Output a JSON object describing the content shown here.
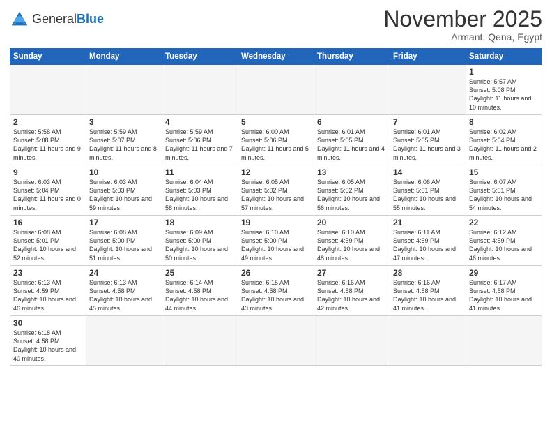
{
  "logo": {
    "general": "General",
    "blue": "Blue"
  },
  "header": {
    "month": "November 2025",
    "subtitle": "Armant, Qena, Egypt"
  },
  "weekdays": [
    "Sunday",
    "Monday",
    "Tuesday",
    "Wednesday",
    "Thursday",
    "Friday",
    "Saturday"
  ],
  "weeks": [
    [
      {
        "day": "",
        "info": ""
      },
      {
        "day": "",
        "info": ""
      },
      {
        "day": "",
        "info": ""
      },
      {
        "day": "",
        "info": ""
      },
      {
        "day": "",
        "info": ""
      },
      {
        "day": "",
        "info": ""
      },
      {
        "day": "1",
        "info": "Sunrise: 5:57 AM\nSunset: 5:08 PM\nDaylight: 11 hours and 10 minutes."
      }
    ],
    [
      {
        "day": "2",
        "info": "Sunrise: 5:58 AM\nSunset: 5:08 PM\nDaylight: 11 hours and 9 minutes."
      },
      {
        "day": "3",
        "info": "Sunrise: 5:59 AM\nSunset: 5:07 PM\nDaylight: 11 hours and 8 minutes."
      },
      {
        "day": "4",
        "info": "Sunrise: 5:59 AM\nSunset: 5:06 PM\nDaylight: 11 hours and 7 minutes."
      },
      {
        "day": "5",
        "info": "Sunrise: 6:00 AM\nSunset: 5:06 PM\nDaylight: 11 hours and 5 minutes."
      },
      {
        "day": "6",
        "info": "Sunrise: 6:01 AM\nSunset: 5:05 PM\nDaylight: 11 hours and 4 minutes."
      },
      {
        "day": "7",
        "info": "Sunrise: 6:01 AM\nSunset: 5:05 PM\nDaylight: 11 hours and 3 minutes."
      },
      {
        "day": "8",
        "info": "Sunrise: 6:02 AM\nSunset: 5:04 PM\nDaylight: 11 hours and 2 minutes."
      }
    ],
    [
      {
        "day": "9",
        "info": "Sunrise: 6:03 AM\nSunset: 5:04 PM\nDaylight: 11 hours and 0 minutes."
      },
      {
        "day": "10",
        "info": "Sunrise: 6:03 AM\nSunset: 5:03 PM\nDaylight: 10 hours and 59 minutes."
      },
      {
        "day": "11",
        "info": "Sunrise: 6:04 AM\nSunset: 5:03 PM\nDaylight: 10 hours and 58 minutes."
      },
      {
        "day": "12",
        "info": "Sunrise: 6:05 AM\nSunset: 5:02 PM\nDaylight: 10 hours and 57 minutes."
      },
      {
        "day": "13",
        "info": "Sunrise: 6:05 AM\nSunset: 5:02 PM\nDaylight: 10 hours and 56 minutes."
      },
      {
        "day": "14",
        "info": "Sunrise: 6:06 AM\nSunset: 5:01 PM\nDaylight: 10 hours and 55 minutes."
      },
      {
        "day": "15",
        "info": "Sunrise: 6:07 AM\nSunset: 5:01 PM\nDaylight: 10 hours and 54 minutes."
      }
    ],
    [
      {
        "day": "16",
        "info": "Sunrise: 6:08 AM\nSunset: 5:01 PM\nDaylight: 10 hours and 52 minutes."
      },
      {
        "day": "17",
        "info": "Sunrise: 6:08 AM\nSunset: 5:00 PM\nDaylight: 10 hours and 51 minutes."
      },
      {
        "day": "18",
        "info": "Sunrise: 6:09 AM\nSunset: 5:00 PM\nDaylight: 10 hours and 50 minutes."
      },
      {
        "day": "19",
        "info": "Sunrise: 6:10 AM\nSunset: 5:00 PM\nDaylight: 10 hours and 49 minutes."
      },
      {
        "day": "20",
        "info": "Sunrise: 6:10 AM\nSunset: 4:59 PM\nDaylight: 10 hours and 48 minutes."
      },
      {
        "day": "21",
        "info": "Sunrise: 6:11 AM\nSunset: 4:59 PM\nDaylight: 10 hours and 47 minutes."
      },
      {
        "day": "22",
        "info": "Sunrise: 6:12 AM\nSunset: 4:59 PM\nDaylight: 10 hours and 46 minutes."
      }
    ],
    [
      {
        "day": "23",
        "info": "Sunrise: 6:13 AM\nSunset: 4:59 PM\nDaylight: 10 hours and 46 minutes."
      },
      {
        "day": "24",
        "info": "Sunrise: 6:13 AM\nSunset: 4:58 PM\nDaylight: 10 hours and 45 minutes."
      },
      {
        "day": "25",
        "info": "Sunrise: 6:14 AM\nSunset: 4:58 PM\nDaylight: 10 hours and 44 minutes."
      },
      {
        "day": "26",
        "info": "Sunrise: 6:15 AM\nSunset: 4:58 PM\nDaylight: 10 hours and 43 minutes."
      },
      {
        "day": "27",
        "info": "Sunrise: 6:16 AM\nSunset: 4:58 PM\nDaylight: 10 hours and 42 minutes."
      },
      {
        "day": "28",
        "info": "Sunrise: 6:16 AM\nSunset: 4:58 PM\nDaylight: 10 hours and 41 minutes."
      },
      {
        "day": "29",
        "info": "Sunrise: 6:17 AM\nSunset: 4:58 PM\nDaylight: 10 hours and 41 minutes."
      }
    ],
    [
      {
        "day": "30",
        "info": "Sunrise: 6:18 AM\nSunset: 4:58 PM\nDaylight: 10 hours and 40 minutes."
      },
      {
        "day": "",
        "info": ""
      },
      {
        "day": "",
        "info": ""
      },
      {
        "day": "",
        "info": ""
      },
      {
        "day": "",
        "info": ""
      },
      {
        "day": "",
        "info": ""
      },
      {
        "day": "",
        "info": ""
      }
    ]
  ]
}
